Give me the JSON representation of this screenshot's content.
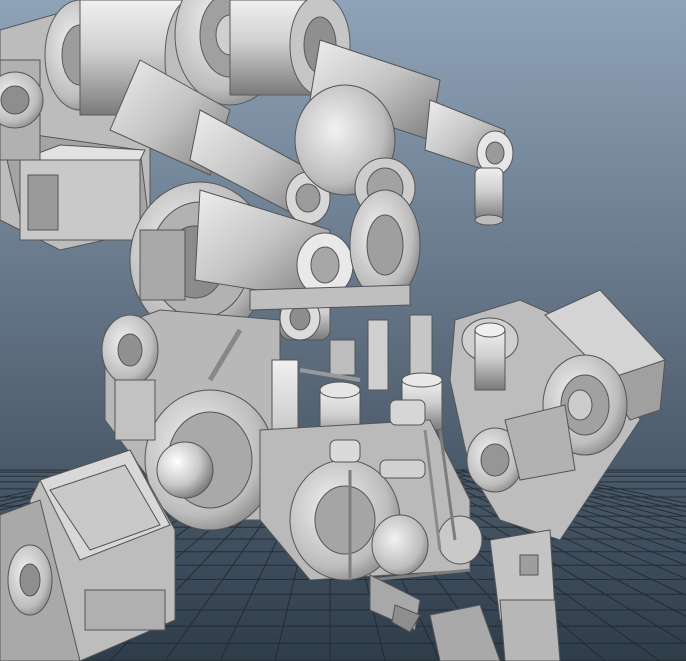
{
  "scene": {
    "background_top": "#8fa3b8",
    "background_bottom": "#2f3c4a",
    "grid_color": "#1f2830",
    "model_light": "#d9d9d9",
    "model_mid": "#a9a9a9",
    "model_dark": "#6f6f6f",
    "model_edge": "#505050"
  }
}
